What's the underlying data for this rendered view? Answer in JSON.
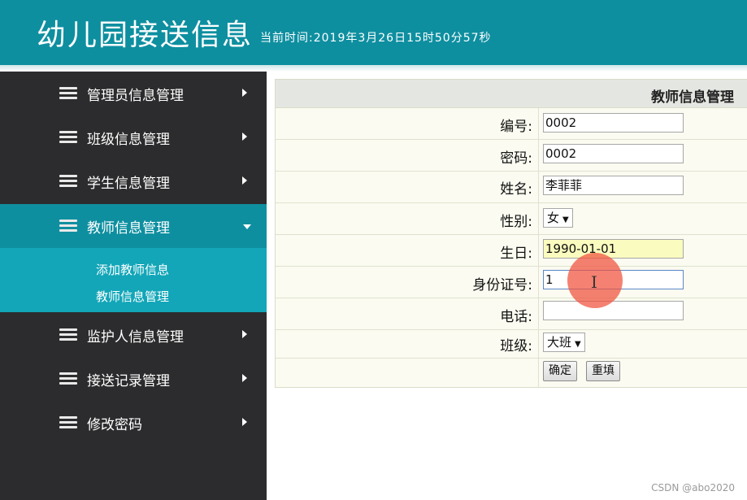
{
  "header": {
    "title": "幼儿园接送信息",
    "time_text": "当前时间:2019年3月26日15时50分57秒"
  },
  "sidebar": {
    "items": [
      {
        "label": "管理员信息管理",
        "icon": "stack-icon"
      },
      {
        "label": "班级信息管理",
        "icon": "stack-icon"
      },
      {
        "label": "学生信息管理",
        "icon": "stack-icon"
      },
      {
        "label": "教师信息管理",
        "icon": "stack-icon",
        "active": true
      },
      {
        "label": "监护人信息管理",
        "icon": "stack-icon"
      },
      {
        "label": "接送记录管理",
        "icon": "stack-icon"
      },
      {
        "label": "修改密码",
        "icon": "stack-icon"
      }
    ],
    "submenu": [
      "添加教师信息",
      "教师信息管理"
    ]
  },
  "form": {
    "title": "教师信息管理",
    "fields": {
      "number": {
        "label": "编号:",
        "value": "0002"
      },
      "password": {
        "label": "密码:",
        "value": "0002"
      },
      "name": {
        "label": "姓名:",
        "value": "李菲菲"
      },
      "gender": {
        "label": "性别:",
        "value": "女"
      },
      "birthday": {
        "label": "生日:",
        "value": "1990-01-01"
      },
      "id_number": {
        "label": "身份证号:",
        "value": "1"
      },
      "phone": {
        "label": "电话:",
        "value": ""
      },
      "class": {
        "label": "班级:",
        "value": "大班"
      }
    },
    "submit_label": "确定",
    "reset_label": "重填"
  },
  "colors": {
    "header_bg": "#0e8fa0",
    "sidebar_bg": "#2c2c2e",
    "submenu_bg": "#12a6b8",
    "birthday_input_bg": "#fafbbe"
  },
  "watermark": "CSDN @abo2020"
}
